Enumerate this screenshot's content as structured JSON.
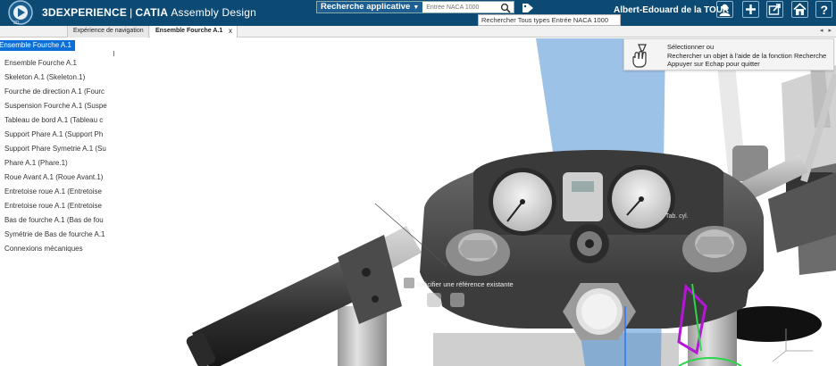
{
  "app": {
    "brand": "3DEXPERIENCE",
    "separator": "|",
    "product": "CATIA",
    "module": "Assembly Design"
  },
  "search": {
    "scope_label": "Recherche applicative",
    "placeholder": "Entrée NACA 1000",
    "tooltip": "Rechercher Tous types Entrée NACA 1000"
  },
  "user": {
    "name": "Albert-Edouard de la TOUR"
  },
  "top_icons": [
    "user-icon",
    "add-icon",
    "share-icon",
    "home-icon",
    "help-icon"
  ],
  "tabs": [
    {
      "label": "Expérience de navigation"
    },
    {
      "label": "Ensemble Fourche A.1",
      "close": "x"
    }
  ],
  "tab_arrows": "◂ ▸",
  "tree": {
    "root": "Ensemble Fourche A.1",
    "items": [
      "Ensemble Fourche A.1",
      "Skeleton A.1 (Skeleton.1)",
      "Fourche de direction A.1 (Fourc",
      "Suspension Fourche A.1 (Suspe",
      "Tableau de bord A.1 (Tableau c",
      "Support Phare A.1 (Support Ph",
      "Support Phare Symetrie A.1 (Su",
      "Phare A.1 (Phare.1)",
      "Roue Avant A.1 (Roue Avant.1)",
      "Entretoise roue A.1 (Entretoise",
      "Entretoise roue A.1 (Entretoise",
      "Bas de fourche A.1 (Bas de fou",
      "Symétrie de Bas de fourche A.1",
      "Connexions mécaniques"
    ]
  },
  "selection_tooltip": {
    "line1": "Sélectionner ou",
    "line2": "Rechercher un objet à l'aide de la fonction Recherche",
    "line3": "Appuyer sur Echap pour quitter"
  },
  "viewport_hint": "Spécifier une référence existante",
  "gauge_tag": "Tab. cyl.",
  "colors": {
    "topbar": "#0c4a74",
    "tree_selection": "#0b6fd9",
    "search_scope": "#1d5f92"
  }
}
